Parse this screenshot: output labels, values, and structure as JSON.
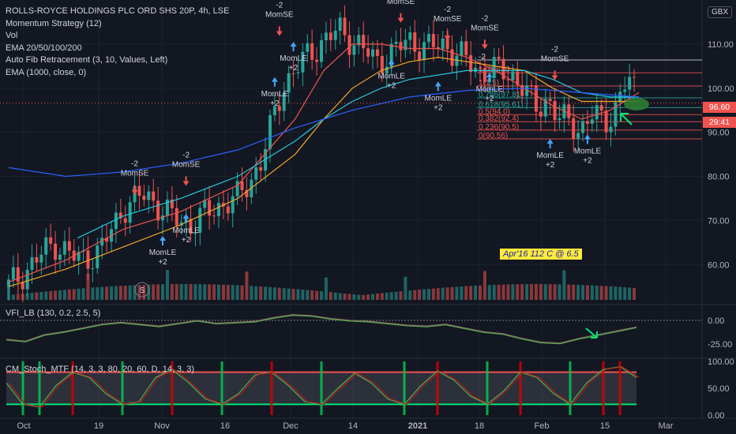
{
  "legend": {
    "symbol": "ROLLS-ROYCE HOLDINGS PLC ORD SHS 20P, 4h, LSE",
    "lines": [
      "Momentum Strategy (12)",
      "Vol",
      "EMA 20/50/100/200",
      "Auto Fib Retracement (3, 10, Values, Left)",
      "EMA (1000, close, 0)"
    ]
  },
  "currency": "GBX",
  "annotation": "Apr'16 112 C @ 6.5",
  "vfi_label": "VFI_LB (130, 0.2, 2.5, 5)",
  "stoch_label": "CM_Stoch_MTF (14, 3, 3, 80, 20, 60, D, 14, 3, 3)",
  "colors": {
    "background": "#131722",
    "up": "#26a69a",
    "down": "#ef5350",
    "ema20": "#ef5350",
    "ema50": "#f5a623",
    "ema100": "#26c6da",
    "ema200": "#2962ff",
    "vfi": "#4caf50",
    "stoch": "#b71c1c"
  },
  "chart_data": {
    "type": "candlestick",
    "x_ticks": [
      "Oct",
      "19",
      "Nov",
      "16",
      "Dec",
      "14",
      "2021",
      "18",
      "Feb",
      "15",
      "Mar"
    ],
    "price_axis": {
      "ticks": [
        60.0,
        70.0,
        80.0,
        90.0,
        100.0,
        110.0
      ],
      "ylim": [
        52,
        120
      ]
    },
    "price_markers": {
      "last": "96.60",
      "countdown": "29:41"
    },
    "closes": [
      [
        0,
        55
      ],
      [
        4,
        60
      ],
      [
        8,
        65
      ],
      [
        12,
        61
      ],
      [
        16,
        63
      ],
      [
        20,
        73
      ],
      [
        24,
        76
      ],
      [
        28,
        71
      ],
      [
        32,
        69
      ],
      [
        36,
        73
      ],
      [
        40,
        75
      ],
      [
        44,
        83
      ],
      [
        48,
        101
      ],
      [
        52,
        107
      ],
      [
        55,
        111
      ],
      [
        58,
        113
      ],
      [
        61,
        110
      ],
      [
        64,
        106
      ],
      [
        67,
        108
      ],
      [
        70,
        111
      ],
      [
        73,
        109
      ],
      [
        76,
        110
      ],
      [
        79,
        107
      ],
      [
        82,
        104
      ],
      [
        85,
        104
      ],
      [
        88,
        103
      ],
      [
        90,
        100
      ],
      [
        92,
        95
      ],
      [
        94,
        98
      ],
      [
        96,
        93
      ],
      [
        98,
        92
      ],
      [
        100,
        91
      ],
      [
        102,
        94
      ],
      [
        104,
        92
      ],
      [
        106,
        96
      ],
      [
        108,
        102
      ],
      [
        109,
        100
      ],
      [
        110,
        97
      ]
    ],
    "ema20": [
      [
        0,
        56
      ],
      [
        10,
        61
      ],
      [
        20,
        68
      ],
      [
        30,
        72
      ],
      [
        40,
        78
      ],
      [
        50,
        93
      ],
      [
        55,
        104
      ],
      [
        60,
        110
      ],
      [
        65,
        110
      ],
      [
        70,
        109
      ],
      [
        75,
        109
      ],
      [
        80,
        107
      ],
      [
        85,
        104
      ],
      [
        90,
        100
      ],
      [
        95,
        96
      ],
      [
        100,
        93
      ],
      [
        105,
        95
      ],
      [
        110,
        99
      ]
    ],
    "ema50": [
      [
        0,
        55
      ],
      [
        10,
        59
      ],
      [
        20,
        64
      ],
      [
        30,
        69
      ],
      [
        40,
        75
      ],
      [
        50,
        85
      ],
      [
        55,
        93
      ],
      [
        60,
        100
      ],
      [
        65,
        104
      ],
      [
        70,
        106
      ],
      [
        75,
        107
      ],
      [
        80,
        106
      ],
      [
        85,
        105
      ],
      [
        90,
        104
      ],
      [
        95,
        100
      ],
      [
        100,
        97
      ],
      [
        105,
        97
      ],
      [
        110,
        97
      ]
    ],
    "ema100": [
      [
        12,
        66
      ],
      [
        20,
        71
      ],
      [
        30,
        75
      ],
      [
        40,
        80
      ],
      [
        50,
        88
      ],
      [
        55,
        93
      ],
      [
        60,
        97
      ],
      [
        65,
        100
      ],
      [
        70,
        102
      ],
      [
        75,
        103
      ],
      [
        80,
        104
      ],
      [
        85,
        104
      ],
      [
        90,
        104
      ],
      [
        95,
        102
      ],
      [
        100,
        99
      ],
      [
        105,
        98
      ],
      [
        110,
        98
      ]
    ],
    "ema200": [
      [
        0,
        82
      ],
      [
        10,
        80
      ],
      [
        20,
        81
      ],
      [
        30,
        83
      ],
      [
        40,
        86
      ],
      [
        50,
        91
      ],
      [
        60,
        95
      ],
      [
        70,
        98
      ],
      [
        80,
        99.5
      ],
      [
        90,
        100
      ],
      [
        100,
        99
      ],
      [
        110,
        98
      ]
    ],
    "fib_levels": [
      {
        "label": "-2",
        "price": 106.4
      },
      {
        "label": "1.618(10",
        "price": 103.5
      },
      {
        "label": "1(1.5)",
        "price": 100.5
      },
      {
        "label": "0.786(97.81)",
        "price": 97.8
      },
      {
        "label": "0.618(95.61)",
        "price": 95.6
      },
      {
        "label": "0.5(94.0)",
        "price": 94.0
      },
      {
        "label": "0.382(92.4)",
        "price": 92.4
      },
      {
        "label": "0.236(90.5)",
        "price": 90.5
      },
      {
        "label": "0(90.56)",
        "price": 88.5
      }
    ],
    "signals": [
      {
        "label": "MomSE",
        "sub": "-2",
        "x": 27,
        "price": 78
      },
      {
        "label": "MomLE",
        "sub": "+2",
        "x": 33,
        "price": 64
      },
      {
        "label": "MomLE",
        "sub": "+2",
        "x": 38,
        "price": 69
      },
      {
        "label": "MomSE",
        "sub": "-2",
        "x": 38,
        "price": 80
      },
      {
        "label": "MomLE",
        "sub": "+2",
        "x": 57,
        "price": 100
      },
      {
        "label": "MomSE",
        "sub": "-2",
        "x": 58,
        "price": 114
      },
      {
        "label": "MomLE",
        "sub": "+2",
        "x": 61,
        "price": 108
      },
      {
        "label": "MomSE",
        "sub": "-2",
        "x": 84,
        "price": 117
      },
      {
        "label": "MomLE",
        "sub": "+2",
        "x": 82,
        "price": 104
      },
      {
        "label": "MomSE",
        "sub": "-2",
        "x": 94,
        "price": 113
      },
      {
        "label": "MomLE",
        "sub": "+2",
        "x": 92,
        "price": 99
      },
      {
        "label": "MomSE",
        "sub": "-2",
        "x": 102,
        "price": 111
      },
      {
        "label": "MomLE",
        "sub": "+2",
        "x": 103,
        "price": 101
      },
      {
        "label": "MomSE",
        "sub": "-2",
        "x": 117,
        "price": 104
      },
      {
        "label": "MomLE",
        "sub": "+2",
        "x": 116,
        "price": 86
      },
      {
        "label": "MomLE",
        "sub": "+2",
        "x": 124,
        "price": 87
      }
    ],
    "vfi": {
      "ticks": [
        "0.00",
        "-25.00"
      ],
      "values": [
        -20,
        -22,
        -15,
        -12,
        -8,
        -4,
        -2,
        -4,
        -6,
        -3,
        0,
        -3,
        -2,
        -1,
        3,
        6,
        5,
        2,
        0,
        -1,
        -3,
        -5,
        -6,
        -4,
        -8,
        -12,
        -14,
        -19,
        -23,
        -24,
        -19,
        -15,
        -11,
        -7
      ]
    },
    "stoch": {
      "ticks": [
        "100.00",
        "50.00",
        "0.00"
      ],
      "levels": [
        80,
        20
      ],
      "values": [
        60,
        20,
        15,
        55,
        80,
        70,
        40,
        20,
        25,
        70,
        85,
        60,
        30,
        20,
        40,
        75,
        80,
        55,
        25,
        20,
        50,
        78,
        60,
        30,
        20,
        55,
        82,
        65,
        35,
        20,
        45,
        80,
        70,
        40,
        20,
        60,
        85,
        90,
        70
      ]
    }
  }
}
